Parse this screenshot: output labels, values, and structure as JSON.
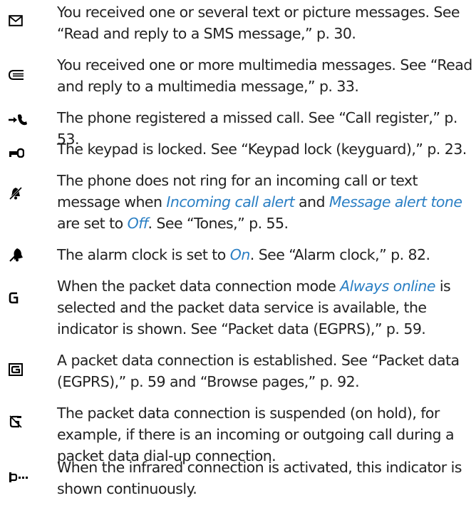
{
  "accent_color": "#2a7fc4",
  "items": [
    {
      "icon": "envelope-icon",
      "parts": [
        "You received one or several text or picture messages. See “Read and reply to a SMS message,” p. 30."
      ]
    },
    {
      "icon": "multimedia-message-icon",
      "parts": [
        "You received one or more multimedia messages. See “Read and reply to a multimedia message,” p. 33."
      ]
    },
    {
      "icon": "missed-call-icon",
      "parts": [
        "The phone registered a missed call. See “Call register,” p. 53."
      ]
    },
    {
      "icon": "keypad-lock-icon",
      "parts": [
        "The keypad is locked. See “Keypad lock (keyguard),” p. 23."
      ]
    },
    {
      "icon": "silent-icon",
      "parts": [
        "The phone does not ring for an incoming call or text message when ",
        "Incoming call alert",
        " and ",
        "Message alert tone",
        " are set to ",
        "Off",
        ". See “Tones,” p. 55."
      ]
    },
    {
      "icon": "alarm-clock-icon",
      "parts": [
        "The alarm clock is set to ",
        "On",
        ". See “Alarm clock,” p. 82."
      ]
    },
    {
      "icon": "packet-data-g-icon",
      "parts": [
        "When the packet data connection mode ",
        "Always online",
        " is selected and the packet data service is available, the indicator is shown. See “Packet data (EGPRS),” p. 59."
      ]
    },
    {
      "icon": "packet-data-active-icon",
      "parts": [
        "A packet data connection is established. See “Packet data (EGPRS),” p. 59 and “Browse pages,” p. 92."
      ]
    },
    {
      "icon": "packet-data-suspended-icon",
      "parts": [
        "The packet data connection is suspended (on hold), for example, if there is an incoming or outgoing call during a packet data dial-up connection."
      ]
    },
    {
      "icon": "infrared-icon",
      "parts": [
        "When the infrared connection is activated, this indicator is shown continuously."
      ]
    }
  ]
}
